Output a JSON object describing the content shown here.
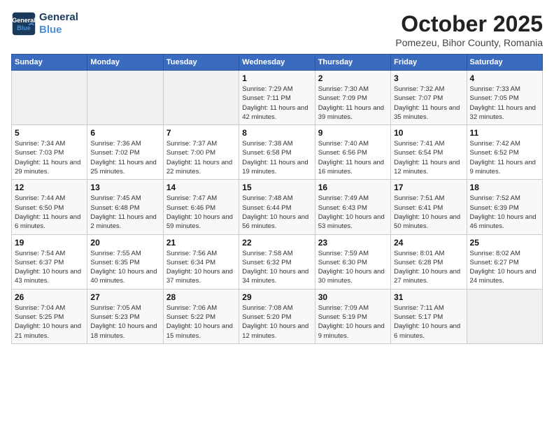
{
  "header": {
    "logo_line1": "General",
    "logo_line2": "Blue",
    "month": "October 2025",
    "location": "Pomezeu, Bihor County, Romania"
  },
  "weekdays": [
    "Sunday",
    "Monday",
    "Tuesday",
    "Wednesday",
    "Thursday",
    "Friday",
    "Saturday"
  ],
  "weeks": [
    [
      {
        "day": "",
        "info": ""
      },
      {
        "day": "",
        "info": ""
      },
      {
        "day": "",
        "info": ""
      },
      {
        "day": "1",
        "info": "Sunrise: 7:29 AM\nSunset: 7:11 PM\nDaylight: 11 hours and 42 minutes."
      },
      {
        "day": "2",
        "info": "Sunrise: 7:30 AM\nSunset: 7:09 PM\nDaylight: 11 hours and 39 minutes."
      },
      {
        "day": "3",
        "info": "Sunrise: 7:32 AM\nSunset: 7:07 PM\nDaylight: 11 hours and 35 minutes."
      },
      {
        "day": "4",
        "info": "Sunrise: 7:33 AM\nSunset: 7:05 PM\nDaylight: 11 hours and 32 minutes."
      }
    ],
    [
      {
        "day": "5",
        "info": "Sunrise: 7:34 AM\nSunset: 7:03 PM\nDaylight: 11 hours and 29 minutes."
      },
      {
        "day": "6",
        "info": "Sunrise: 7:36 AM\nSunset: 7:02 PM\nDaylight: 11 hours and 25 minutes."
      },
      {
        "day": "7",
        "info": "Sunrise: 7:37 AM\nSunset: 7:00 PM\nDaylight: 11 hours and 22 minutes."
      },
      {
        "day": "8",
        "info": "Sunrise: 7:38 AM\nSunset: 6:58 PM\nDaylight: 11 hours and 19 minutes."
      },
      {
        "day": "9",
        "info": "Sunrise: 7:40 AM\nSunset: 6:56 PM\nDaylight: 11 hours and 16 minutes."
      },
      {
        "day": "10",
        "info": "Sunrise: 7:41 AM\nSunset: 6:54 PM\nDaylight: 11 hours and 12 minutes."
      },
      {
        "day": "11",
        "info": "Sunrise: 7:42 AM\nSunset: 6:52 PM\nDaylight: 11 hours and 9 minutes."
      }
    ],
    [
      {
        "day": "12",
        "info": "Sunrise: 7:44 AM\nSunset: 6:50 PM\nDaylight: 11 hours and 6 minutes."
      },
      {
        "day": "13",
        "info": "Sunrise: 7:45 AM\nSunset: 6:48 PM\nDaylight: 11 hours and 2 minutes."
      },
      {
        "day": "14",
        "info": "Sunrise: 7:47 AM\nSunset: 6:46 PM\nDaylight: 10 hours and 59 minutes."
      },
      {
        "day": "15",
        "info": "Sunrise: 7:48 AM\nSunset: 6:44 PM\nDaylight: 10 hours and 56 minutes."
      },
      {
        "day": "16",
        "info": "Sunrise: 7:49 AM\nSunset: 6:43 PM\nDaylight: 10 hours and 53 minutes."
      },
      {
        "day": "17",
        "info": "Sunrise: 7:51 AM\nSunset: 6:41 PM\nDaylight: 10 hours and 50 minutes."
      },
      {
        "day": "18",
        "info": "Sunrise: 7:52 AM\nSunset: 6:39 PM\nDaylight: 10 hours and 46 minutes."
      }
    ],
    [
      {
        "day": "19",
        "info": "Sunrise: 7:54 AM\nSunset: 6:37 PM\nDaylight: 10 hours and 43 minutes."
      },
      {
        "day": "20",
        "info": "Sunrise: 7:55 AM\nSunset: 6:35 PM\nDaylight: 10 hours and 40 minutes."
      },
      {
        "day": "21",
        "info": "Sunrise: 7:56 AM\nSunset: 6:34 PM\nDaylight: 10 hours and 37 minutes."
      },
      {
        "day": "22",
        "info": "Sunrise: 7:58 AM\nSunset: 6:32 PM\nDaylight: 10 hours and 34 minutes."
      },
      {
        "day": "23",
        "info": "Sunrise: 7:59 AM\nSunset: 6:30 PM\nDaylight: 10 hours and 30 minutes."
      },
      {
        "day": "24",
        "info": "Sunrise: 8:01 AM\nSunset: 6:28 PM\nDaylight: 10 hours and 27 minutes."
      },
      {
        "day": "25",
        "info": "Sunrise: 8:02 AM\nSunset: 6:27 PM\nDaylight: 10 hours and 24 minutes."
      }
    ],
    [
      {
        "day": "26",
        "info": "Sunrise: 7:04 AM\nSunset: 5:25 PM\nDaylight: 10 hours and 21 minutes."
      },
      {
        "day": "27",
        "info": "Sunrise: 7:05 AM\nSunset: 5:23 PM\nDaylight: 10 hours and 18 minutes."
      },
      {
        "day": "28",
        "info": "Sunrise: 7:06 AM\nSunset: 5:22 PM\nDaylight: 10 hours and 15 minutes."
      },
      {
        "day": "29",
        "info": "Sunrise: 7:08 AM\nSunset: 5:20 PM\nDaylight: 10 hours and 12 minutes."
      },
      {
        "day": "30",
        "info": "Sunrise: 7:09 AM\nSunset: 5:19 PM\nDaylight: 10 hours and 9 minutes."
      },
      {
        "day": "31",
        "info": "Sunrise: 7:11 AM\nSunset: 5:17 PM\nDaylight: 10 hours and 6 minutes."
      },
      {
        "day": "",
        "info": ""
      }
    ]
  ]
}
